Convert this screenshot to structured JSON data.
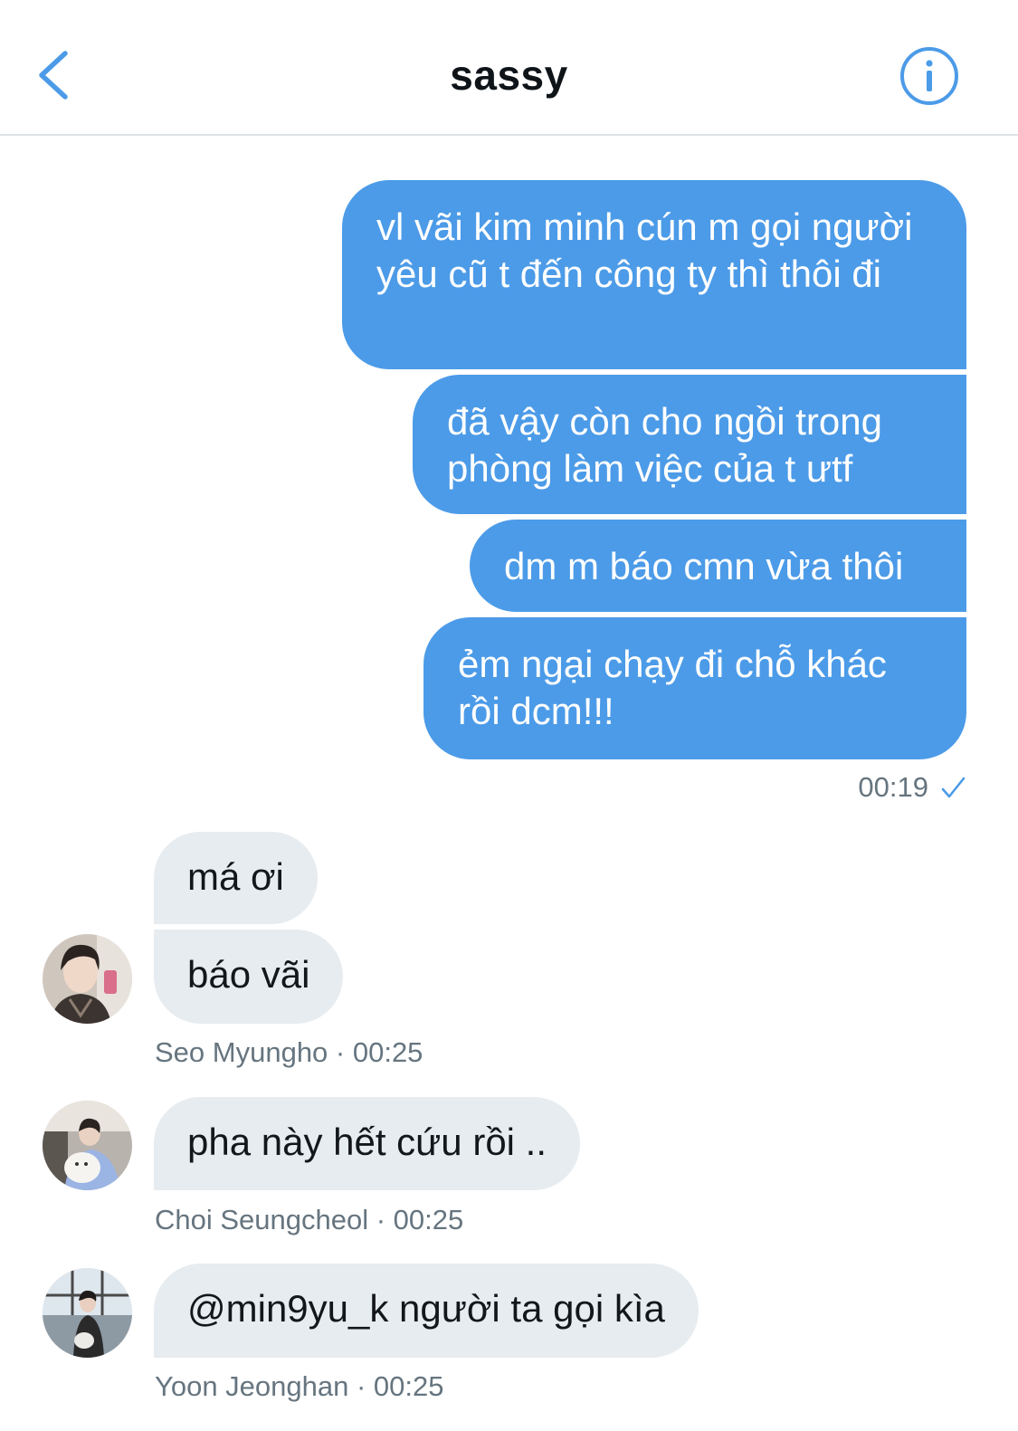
{
  "header": {
    "title": "sassy",
    "back_icon": "chevron-left-icon",
    "info_icon": "info-circle-icon",
    "accent_color": "#4c9be8"
  },
  "outgoing": {
    "messages": [
      "vl vãi kim minh cún m gọi người yêu cũ t đến công ty thì thôi đi",
      "đã vậy còn cho ngồi trong phòng làm việc của t ưtf",
      "dm m báo cmn vừa thôi",
      "ẻm ngại chạy đi chỗ khác rồi dcm!!!"
    ],
    "time": "00:19",
    "status_icon": "checkmark-icon"
  },
  "incoming": [
    {
      "messages": [
        "má ơi",
        "báo vãi"
      ],
      "meta": "Seo Myungho · 00:25"
    },
    {
      "messages": [
        "pha này hết cứu rồi .."
      ],
      "meta": "Choi Seungcheol · 00:25"
    },
    {
      "messages": [
        "@min9yu_k người ta gọi kìa"
      ],
      "meta": "Yoon Jeonghan · 00:25"
    }
  ]
}
